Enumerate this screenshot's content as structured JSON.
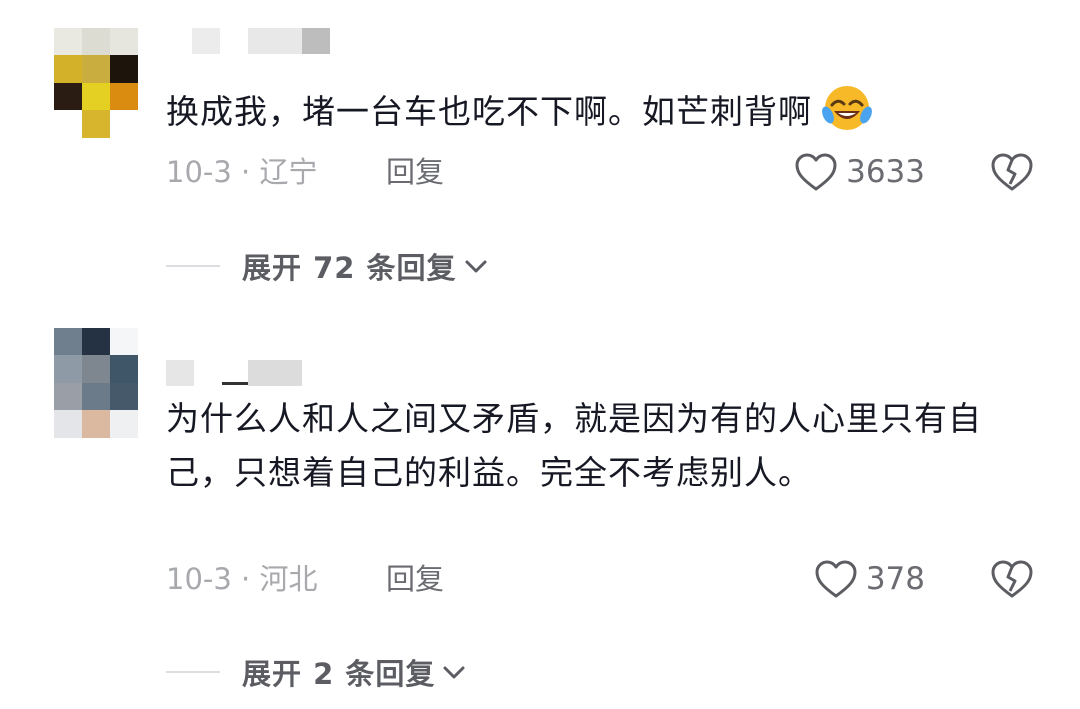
{
  "comments": [
    {
      "text": "换成我，堵一台车也吃不下啊。如芒刺背啊",
      "emoji": "rofl-emoji",
      "date_location": "10-3 · 辽宁",
      "reply_label": "回复",
      "likes": "3633",
      "expand_label": "展开 72 条回复"
    },
    {
      "text": "为什么人和人之间又矛盾，就是因为有的人心里只有自己，只想着自己的利益。完全不考虑别人。",
      "date_location": "10-3 · 河北",
      "reply_label": "回复",
      "likes": "378",
      "expand_label": "展开 2 条回复"
    }
  ],
  "colors": {
    "text": "#161823",
    "meta": "#a8a9ad",
    "action": "#6b6c72"
  }
}
